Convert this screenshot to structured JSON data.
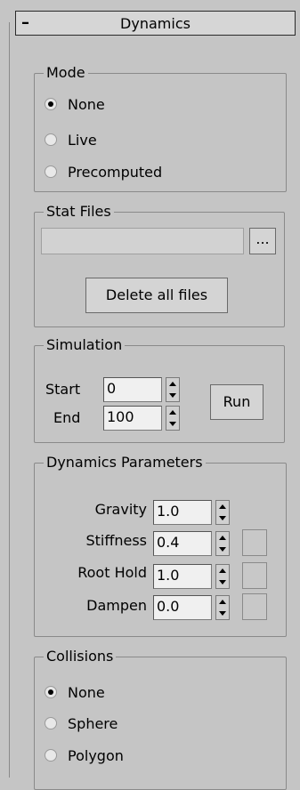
{
  "rollout": {
    "collapse_symbol": "–",
    "title": "Dynamics"
  },
  "mode": {
    "title": "Mode",
    "options": [
      {
        "label": "None",
        "checked": true
      },
      {
        "label": "Live",
        "checked": false
      },
      {
        "label": "Precomputed",
        "checked": false
      }
    ]
  },
  "stat_files": {
    "title": "Stat Files",
    "path_value": "",
    "browse_label": "...",
    "delete_label": "Delete all files"
  },
  "simulation": {
    "title": "Simulation",
    "start_label": "Start",
    "start_value": "0",
    "end_label": "End",
    "end_value": "100",
    "run_label": "Run"
  },
  "dynamics_parameters": {
    "title": "Dynamics Parameters",
    "params": [
      {
        "label": "Gravity",
        "value": "1.0"
      },
      {
        "label": "Stiffness",
        "value": "0.4"
      },
      {
        "label": "Root Hold",
        "value": "1.0"
      },
      {
        "label": "Dampen",
        "value": "0.0"
      }
    ]
  },
  "collisions": {
    "title": "Collisions",
    "options": [
      {
        "label": "None",
        "checked": true
      },
      {
        "label": "Sphere",
        "checked": false
      },
      {
        "label": "Polygon",
        "checked": false
      }
    ]
  }
}
